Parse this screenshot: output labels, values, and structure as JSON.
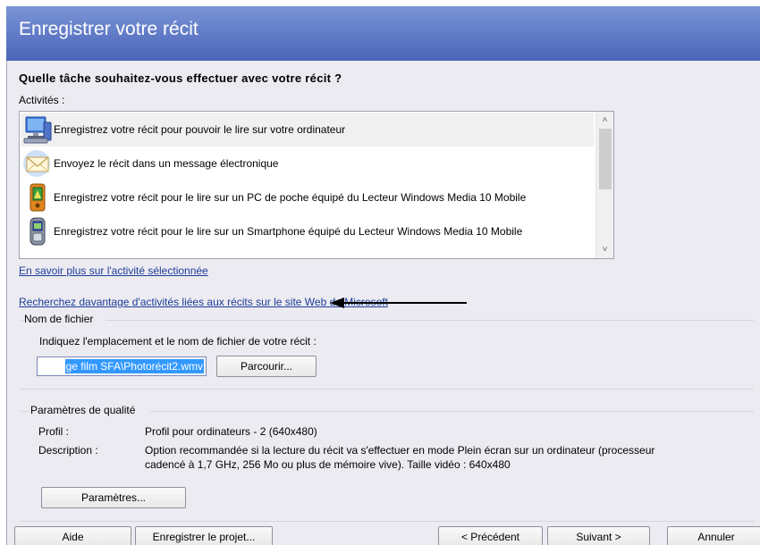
{
  "window": {
    "title": "Enregistrer votre récit"
  },
  "main": {
    "question": "Quelle tâche souhaitez-vous effectuer avec votre récit ?",
    "activities_label": "Activités :",
    "activities": [
      {
        "icon": "computer-icon",
        "label": "Enregistrez votre récit pour pouvoir le lire sur votre ordinateur",
        "selected": true
      },
      {
        "icon": "email-icon",
        "label": "Envoyez le récit dans un message électronique",
        "selected": false
      },
      {
        "icon": "pocket-pc-icon",
        "label": "Enregistrez votre récit pour le lire sur un PC de poche équipé du Lecteur Windows Media 10 Mobile",
        "selected": false
      },
      {
        "icon": "smartphone-icon",
        "label": "Enregistrez votre récit pour le lire sur un Smartphone équipé du Lecteur Windows Media 10 Mobile",
        "selected": false
      }
    ],
    "learn_more_link": "En savoir plus sur l'activité sélectionnée",
    "more_activities_link": "Recherchez davantage d'activités liées aux récits sur le site Web de Microsoft"
  },
  "filename": {
    "group_title": "Nom de fichier",
    "instruction": "Indiquez l'emplacement et le nom de fichier de votre récit :",
    "value": "ge film SFA\\Photorécit2.wmv",
    "browse_label": "Parcourir..."
  },
  "quality": {
    "group_title": "Paramètres de qualité",
    "profile_label": "Profil :",
    "profile_value": "Profil pour ordinateurs - 2 (640x480)",
    "description_label": "Description :",
    "description_line1": "Option recommandée si la lecture du récit va s'effectuer en mode Plein écran sur un ordinateur (processeur",
    "description_line2": "cadencé à 1,7 GHz, 256 Mo ou plus de mémoire vive). Taille vidéo : 640x480",
    "settings_label": "Paramètres..."
  },
  "footer": {
    "help": "Aide",
    "save_project": "Enregistrer le projet...",
    "previous": "< Précédent",
    "next": "Suivant >",
    "cancel": "Annuler"
  },
  "colors": {
    "header": "#5f79c6",
    "panel": "#ecebf1",
    "link": "#1c3c99",
    "selection": "#3399ff"
  }
}
